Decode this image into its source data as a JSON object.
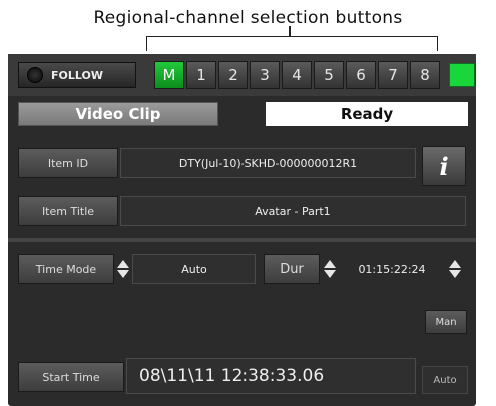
{
  "callout": {
    "text": "Regional-channel selection buttons"
  },
  "topbar": {
    "follow_label": "FOLLOW",
    "channels": [
      "M",
      "1",
      "2",
      "3",
      "4",
      "5",
      "6",
      "7",
      "8"
    ],
    "active_channel": "M",
    "status_color": "#19d63a"
  },
  "clip": {
    "type_label": "Video Clip",
    "status": "Ready"
  },
  "item": {
    "id_label": "Item ID",
    "id_value": "DTY(Jul-10)-SKHD-000000012R1",
    "info_icon": "i",
    "title_label": "Item Title",
    "title_value": "Avatar - Part1"
  },
  "timing": {
    "time_mode_label": "Time Mode",
    "time_mode_value": "Auto",
    "dur_label": "Dur",
    "dur_value": "01:15:22:24",
    "man_label": "Man",
    "start_time_label": "Start Time",
    "start_time_value": "08\\11\\11 12:38:33.06",
    "auto_label": "Auto"
  }
}
